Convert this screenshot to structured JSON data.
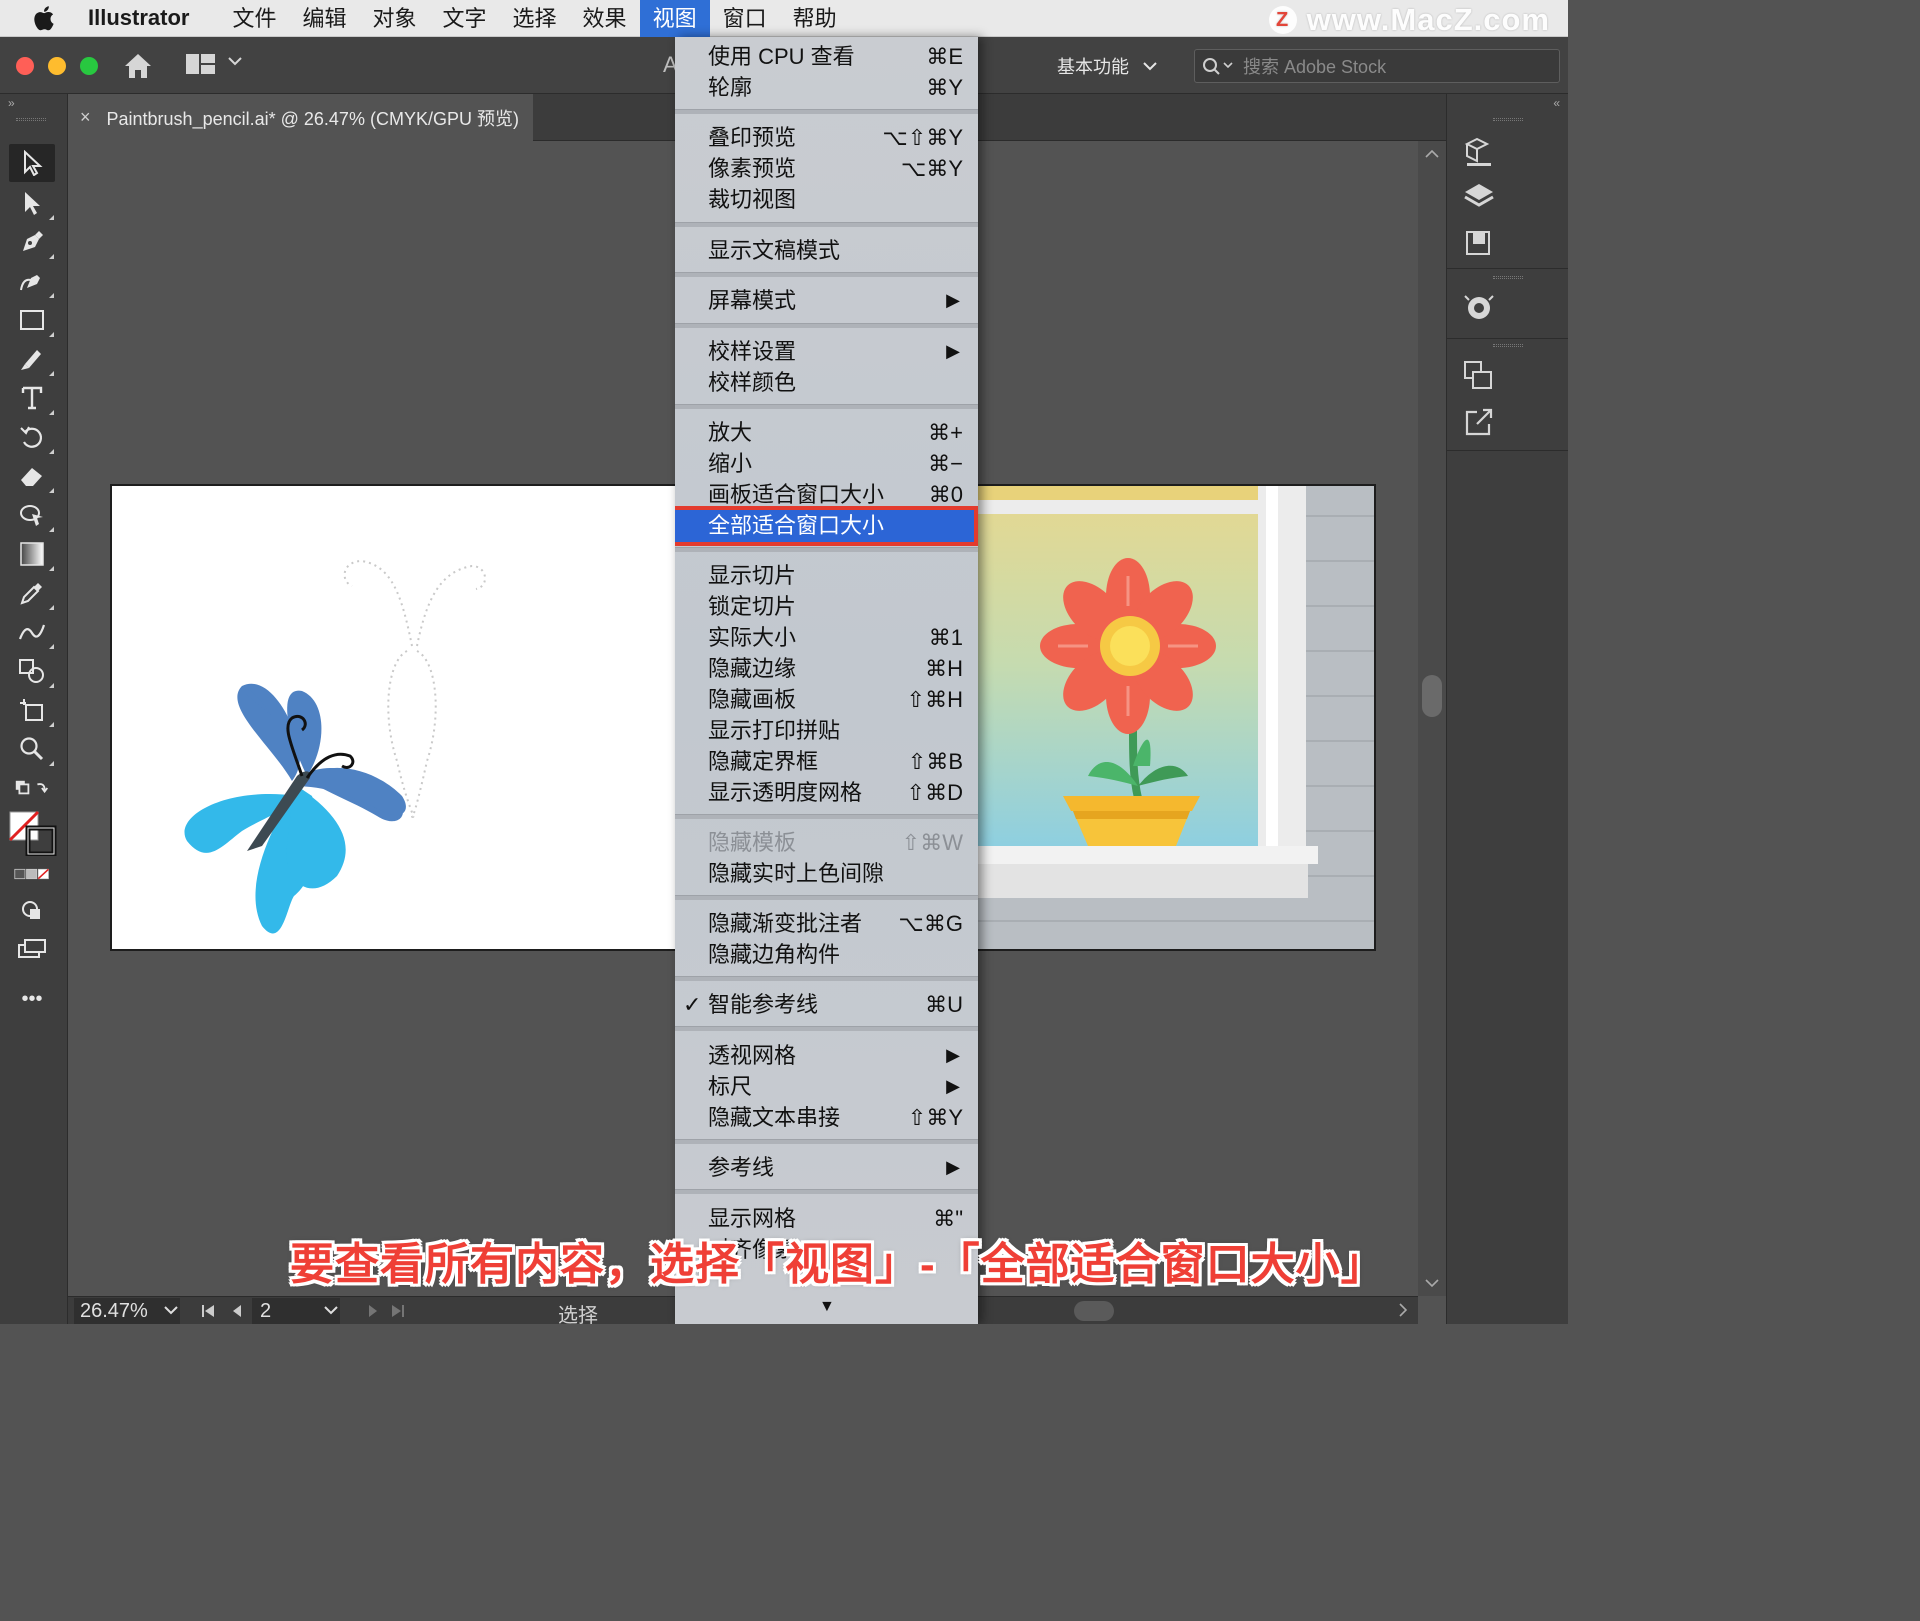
{
  "menubar": {
    "app_name": "Illustrator",
    "items": [
      "文件",
      "编辑",
      "对象",
      "文字",
      "选择",
      "效果",
      "视图",
      "窗口",
      "帮助"
    ],
    "active_index": 6
  },
  "watermark": {
    "logo": "Z",
    "text": "www.MacZ.com"
  },
  "toolbar": {
    "partial_label": "A",
    "workspace_label": "基本功能",
    "search_placeholder": "搜索 Adobe Stock"
  },
  "document_tab": {
    "close_glyph": "×",
    "title": "Paintbrush_pencil.ai* @ 26.47% (CMYK/GPU 预览)"
  },
  "panel_glyphs": {
    "collapse_left": "»",
    "collapse_right": "«",
    "more_tools": "•••"
  },
  "view_menu": {
    "items": [
      {
        "label": "使用 CPU 查看",
        "shortcut": "⌘E"
      },
      {
        "label": "轮廓",
        "shortcut": "⌘Y"
      },
      {
        "label": "叠印预览",
        "shortcut": "⌥⇧⌘Y"
      },
      {
        "label": "像素预览",
        "shortcut": "⌥⌘Y"
      },
      {
        "label": "裁切视图",
        "shortcut": ""
      },
      {
        "label": "显示文稿模式",
        "shortcut": ""
      },
      {
        "label": "屏幕模式",
        "shortcut": ""
      },
      {
        "label": "校样设置",
        "shortcut": ""
      },
      {
        "label": "校样颜色",
        "shortcut": ""
      },
      {
        "label": "放大",
        "shortcut": "⌘+"
      },
      {
        "label": "缩小",
        "shortcut": "⌘−"
      },
      {
        "label": "画板适合窗口大小",
        "shortcut": "⌘0"
      },
      {
        "label": "全部适合窗口大小",
        "shortcut": ""
      },
      {
        "label": "显示切片",
        "shortcut": ""
      },
      {
        "label": "锁定切片",
        "shortcut": ""
      },
      {
        "label": "实际大小",
        "shortcut": "⌘1"
      },
      {
        "label": "隐藏边缘",
        "shortcut": "⌘H"
      },
      {
        "label": "隐藏画板",
        "shortcut": "⇧⌘H"
      },
      {
        "label": "显示打印拼贴",
        "shortcut": ""
      },
      {
        "label": "隐藏定界框",
        "shortcut": "⇧⌘B"
      },
      {
        "label": "显示透明度网格",
        "shortcut": "⇧⌘D"
      },
      {
        "label": "隐藏模板",
        "shortcut": "⇧⌘W"
      },
      {
        "label": "隐藏实时上色间隙",
        "shortcut": ""
      },
      {
        "label": "隐藏渐变批注者",
        "shortcut": "⌥⌘G"
      },
      {
        "label": "隐藏边角构件",
        "shortcut": ""
      },
      {
        "label": "智能参考线",
        "shortcut": "⌘U"
      },
      {
        "label": "透视网格",
        "shortcut": ""
      },
      {
        "label": "标尺",
        "shortcut": ""
      },
      {
        "label": "隐藏文本串接",
        "shortcut": "⇧⌘Y"
      },
      {
        "label": "参考线",
        "shortcut": ""
      },
      {
        "label": "显示网格",
        "shortcut": "⌘\""
      },
      {
        "label": "对齐像素",
        "shortcut": ""
      }
    ],
    "submenu_arrow": "▶",
    "check_glyph": "✓",
    "scroll_arrow": "▼",
    "highlighted_item": "全部适合窗口大小",
    "disabled_item": "隐藏模板",
    "checked_item": "智能参考线"
  },
  "statusbar": {
    "zoom": "26.47%",
    "artboard_number": "2",
    "status": "选择"
  },
  "caption": "要查看所有内容，选择「视图」-「全部适合窗口大小」",
  "colors": {
    "menu_highlight": "#2c65d6",
    "highlight_border": "#e33b2e",
    "caption_red": "#ef3f36",
    "butterfly_dark_blue": "#4f82c3",
    "butterfly_light_blue": "#33b9ea",
    "flower_petal": "#f0634f",
    "flower_center": "#f6c944",
    "pot": "#f5b82e"
  }
}
